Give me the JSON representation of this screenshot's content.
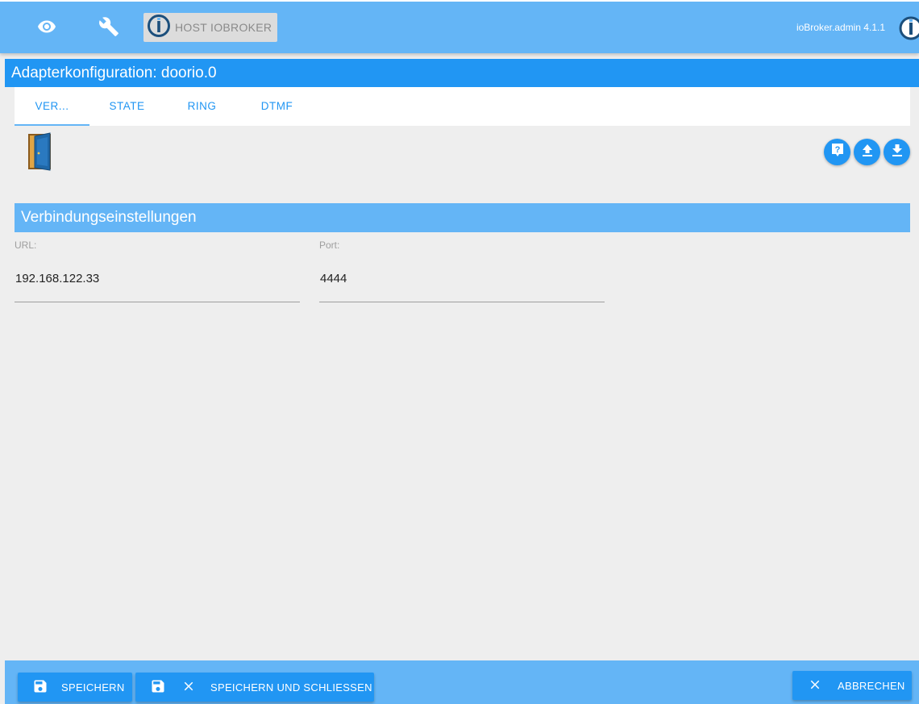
{
  "header": {
    "host_button_label": "HOST IOBROKER",
    "version": "ioBroker.admin 4.1.1"
  },
  "page": {
    "title": "Adapterkonfiguration: doorio.0"
  },
  "tabs": [
    {
      "label": "VER...",
      "active": true
    },
    {
      "label": "STATE",
      "active": false
    },
    {
      "label": "RING",
      "active": false
    },
    {
      "label": "DTMF",
      "active": false
    }
  ],
  "section": {
    "title": "Verbindungseinstellungen",
    "fields": [
      {
        "label": "URL:",
        "value": "192.168.122.33"
      },
      {
        "label": "Port:",
        "value": "4444"
      }
    ]
  },
  "footer": {
    "save_label": "SPEICHERN",
    "save_close_label": "SPEICHERN UND SCHLIESSEN",
    "cancel_label": "ABBRECHEN"
  },
  "colors": {
    "topbar": "#64b5f6",
    "primary": "#2196f3",
    "background": "#eeeeee",
    "host_button_bg": "#dcdcdc"
  },
  "icons": {
    "visibility": "eye-icon",
    "settings": "wrench-icon",
    "logo": "iobroker-logo-icon",
    "adapter": "door-icon",
    "help": "help-icon",
    "upload": "upload-icon",
    "download": "download-icon",
    "save": "floppy-disk-icon",
    "close": "close-icon"
  }
}
